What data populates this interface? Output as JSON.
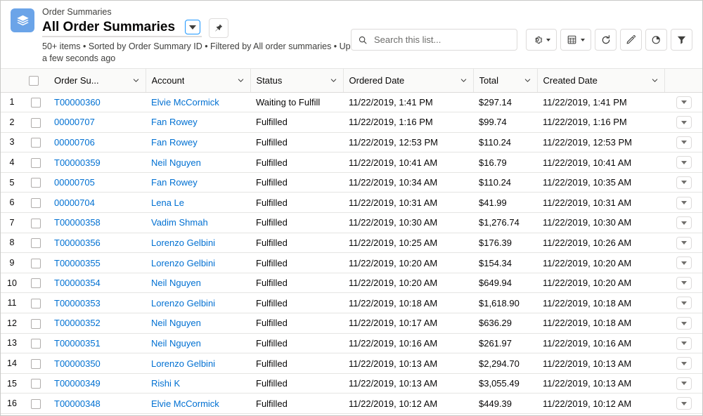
{
  "header": {
    "app_icon": "layers-icon",
    "eyebrow": "Order Summaries",
    "title": "All Order Summaries",
    "title_dropdown_icon": "chevron-down-icon",
    "pin_icon": "pin-icon",
    "meta": "50+ items • Sorted by Order Summary ID • Filtered by All order summaries • Updated a few seconds ago"
  },
  "toolbar": {
    "search_placeholder": "Search this list...",
    "search_value": "",
    "search_icon": "search-icon",
    "buttons": [
      {
        "name": "list-view-controls-button",
        "icon": "gear-icon",
        "has_caret": true
      },
      {
        "name": "display-as-button",
        "icon": "table-icon",
        "has_caret": true
      },
      {
        "name": "refresh-button",
        "icon": "refresh-icon",
        "has_caret": false
      },
      {
        "name": "edit-button",
        "icon": "pencil-icon",
        "has_caret": false
      },
      {
        "name": "chart-button",
        "icon": "pie-chart-icon",
        "has_caret": false
      },
      {
        "name": "filter-button",
        "icon": "funnel-icon",
        "has_caret": false
      }
    ]
  },
  "table": {
    "select_all_label": "",
    "columns": [
      {
        "label": "Order Su...",
        "key": "order_summary"
      },
      {
        "label": "Account",
        "key": "account"
      },
      {
        "label": "Status",
        "key": "status"
      },
      {
        "label": "Ordered Date",
        "key": "ordered_date"
      },
      {
        "label": "Total",
        "key": "total"
      },
      {
        "label": "Created Date",
        "key": "created_date"
      }
    ],
    "rows": [
      {
        "num": "1",
        "order_summary": "T00000360",
        "account": "Elvie McCormick",
        "status": "Waiting to Fulfill",
        "ordered_date": "11/22/2019, 1:41 PM",
        "total": "$297.14",
        "created_date": "11/22/2019, 1:41 PM"
      },
      {
        "num": "2",
        "order_summary": "00000707",
        "account": "Fan Rowey",
        "status": "Fulfilled",
        "ordered_date": "11/22/2019, 1:16 PM",
        "total": "$99.74",
        "created_date": "11/22/2019, 1:16 PM"
      },
      {
        "num": "3",
        "order_summary": "00000706",
        "account": "Fan Rowey",
        "status": "Fulfilled",
        "ordered_date": "11/22/2019, 12:53 PM",
        "total": "$110.24",
        "created_date": "11/22/2019, 12:53 PM"
      },
      {
        "num": "4",
        "order_summary": "T00000359",
        "account": "Neil Nguyen",
        "status": "Fulfilled",
        "ordered_date": "11/22/2019, 10:41 AM",
        "total": "$16.79",
        "created_date": "11/22/2019, 10:41 AM"
      },
      {
        "num": "5",
        "order_summary": "00000705",
        "account": "Fan Rowey",
        "status": "Fulfilled",
        "ordered_date": "11/22/2019, 10:34 AM",
        "total": "$110.24",
        "created_date": "11/22/2019, 10:35 AM"
      },
      {
        "num": "6",
        "order_summary": "00000704",
        "account": "Lena Le",
        "status": "Fulfilled",
        "ordered_date": "11/22/2019, 10:31 AM",
        "total": "$41.99",
        "created_date": "11/22/2019, 10:31 AM"
      },
      {
        "num": "7",
        "order_summary": "T00000358",
        "account": "Vadim Shmah",
        "status": "Fulfilled",
        "ordered_date": "11/22/2019, 10:30 AM",
        "total": "$1,276.74",
        "created_date": "11/22/2019, 10:30 AM"
      },
      {
        "num": "8",
        "order_summary": "T00000356",
        "account": "Lorenzo Gelbini",
        "status": "Fulfilled",
        "ordered_date": "11/22/2019, 10:25 AM",
        "total": "$176.39",
        "created_date": "11/22/2019, 10:26 AM"
      },
      {
        "num": "9",
        "order_summary": "T00000355",
        "account": "Lorenzo Gelbini",
        "status": "Fulfilled",
        "ordered_date": "11/22/2019, 10:20 AM",
        "total": "$154.34",
        "created_date": "11/22/2019, 10:20 AM"
      },
      {
        "num": "10",
        "order_summary": "T00000354",
        "account": "Neil Nguyen",
        "status": "Fulfilled",
        "ordered_date": "11/22/2019, 10:20 AM",
        "total": "$649.94",
        "created_date": "11/22/2019, 10:20 AM"
      },
      {
        "num": "11",
        "order_summary": "T00000353",
        "account": "Lorenzo Gelbini",
        "status": "Fulfilled",
        "ordered_date": "11/22/2019, 10:18 AM",
        "total": "$1,618.90",
        "created_date": "11/22/2019, 10:18 AM"
      },
      {
        "num": "12",
        "order_summary": "T00000352",
        "account": "Neil Nguyen",
        "status": "Fulfilled",
        "ordered_date": "11/22/2019, 10:17 AM",
        "total": "$636.29",
        "created_date": "11/22/2019, 10:18 AM"
      },
      {
        "num": "13",
        "order_summary": "T00000351",
        "account": "Neil Nguyen",
        "status": "Fulfilled",
        "ordered_date": "11/22/2019, 10:16 AM",
        "total": "$261.97",
        "created_date": "11/22/2019, 10:16 AM"
      },
      {
        "num": "14",
        "order_summary": "T00000350",
        "account": "Lorenzo Gelbini",
        "status": "Fulfilled",
        "ordered_date": "11/22/2019, 10:13 AM",
        "total": "$2,294.70",
        "created_date": "11/22/2019, 10:13 AM"
      },
      {
        "num": "15",
        "order_summary": "T00000349",
        "account": "Rishi K",
        "status": "Fulfilled",
        "ordered_date": "11/22/2019, 10:13 AM",
        "total": "$3,055.49",
        "created_date": "11/22/2019, 10:13 AM"
      },
      {
        "num": "16",
        "order_summary": "T00000348",
        "account": "Elvie McCormick",
        "status": "Fulfilled",
        "ordered_date": "11/22/2019, 10:12 AM",
        "total": "$449.39",
        "created_date": "11/22/2019, 10:12 AM"
      }
    ],
    "row_action_icon": "chevron-down-icon"
  },
  "colors": {
    "link": "#0070d2",
    "app_icon_bg": "#6ba4e8",
    "header_bg": "#fafaf9",
    "border": "#e5e5e3",
    "accent_blue": "#1b96ff"
  }
}
